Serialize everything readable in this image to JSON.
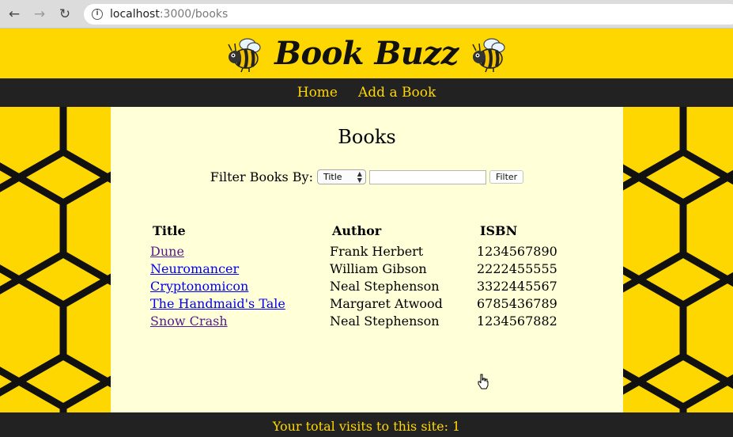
{
  "browser": {
    "url_host": "localhost",
    "url_path": ":3000/books",
    "nav_icons": [
      "back-arrow-icon",
      "forward-arrow-icon",
      "reload-icon",
      "info-icon"
    ]
  },
  "header": {
    "title": "Book Buzz",
    "logo_icon": "bee-icon"
  },
  "nav": {
    "items": [
      {
        "label": "Home"
      },
      {
        "label": "Add a Book"
      }
    ]
  },
  "main": {
    "title": "Books",
    "filter": {
      "label": "Filter Books By:",
      "selected": "Title",
      "input_value": "",
      "button_label": "Filter"
    },
    "table": {
      "headers": [
        "Title",
        "Author",
        "ISBN"
      ],
      "rows": [
        {
          "title": "Dune",
          "author": "Frank Herbert",
          "isbn": "1234567890",
          "visited": true
        },
        {
          "title": "Neuromancer",
          "author": "William Gibson",
          "isbn": "2222455555",
          "visited": false
        },
        {
          "title": "Cryptonomicon",
          "author": "Neal Stephenson",
          "isbn": "3322445567",
          "visited": false
        },
        {
          "title": "The Handmaid's Tale",
          "author": "Margaret Atwood",
          "isbn": "6785436789",
          "visited": false
        },
        {
          "title": "Snow Crash",
          "author": "Neal Stephenson",
          "isbn": "1234567882",
          "visited": true
        }
      ]
    }
  },
  "footer": {
    "text": "Your total visits to this site: 1"
  },
  "colors": {
    "honey": "#ffd700",
    "dark": "#222222",
    "cream": "#ffffd8",
    "link": "#0000ee",
    "visited": "#551a8b"
  }
}
